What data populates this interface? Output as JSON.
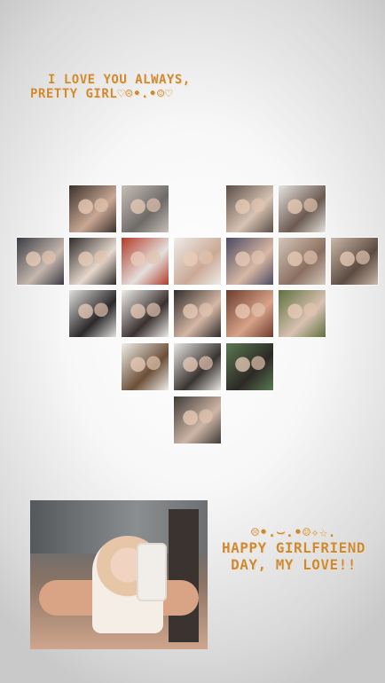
{
  "captions": {
    "top_line1": "i LOVE YOU ALWAYS,",
    "top_line2": "PRETTY giRL♡☹•.•☺♡",
    "bottom_deco": "☹•.⌣.•☺✧☆.",
    "bottom_line1": "HAPPY girLFRiEND",
    "bottom_line2": "DAY, MY LOVE!!"
  },
  "colors": {
    "caption": "#c98a3a"
  },
  "tiles": [
    {
      "id": "tile-1",
      "c1": "#3b302c",
      "c2": "#c9a894"
    },
    {
      "id": "tile-2",
      "c1": "#c7c0b8",
      "c2": "#6e6a66"
    },
    {
      "id": "tile-3",
      "c1": "#5a4d45",
      "c2": "#d7c3b4"
    },
    {
      "id": "tile-4",
      "c1": "#e7e3de",
      "c2": "#6b5a50"
    },
    {
      "id": "tile-5",
      "c1": "#3a3c44",
      "c2": "#c5b7ae"
    },
    {
      "id": "tile-6",
      "c1": "#2e2b2a",
      "c2": "#e6d8cd"
    },
    {
      "id": "tile-7",
      "c1": "#b33a2a",
      "c2": "#e3e0dc"
    },
    {
      "id": "tile-8",
      "c1": "#efece8",
      "c2": "#caa996"
    },
    {
      "id": "tile-9",
      "c1": "#4b4a63",
      "c2": "#d8b8a4"
    },
    {
      "id": "tile-10",
      "c1": "#d5c7bb",
      "c2": "#8a6f60"
    },
    {
      "id": "tile-11",
      "c1": "#cbb9a9",
      "c2": "#5c4b41"
    },
    {
      "id": "tile-12",
      "c1": "#e2e0dd",
      "c2": "#2a2829"
    },
    {
      "id": "tile-13",
      "c1": "#f0eeeb",
      "c2": "#3a3030"
    },
    {
      "id": "tile-14",
      "c1": "#2f2b2a",
      "c2": "#d6b8a6"
    },
    {
      "id": "tile-15",
      "c1": "#6a3b2a",
      "c2": "#d8a38a"
    },
    {
      "id": "tile-16",
      "c1": "#5e6f3e",
      "c2": "#d9c2b3"
    },
    {
      "id": "tile-17",
      "c1": "#f1efe9",
      "c2": "#6b4f38"
    },
    {
      "id": "tile-18",
      "c1": "#e9e7e5",
      "c2": "#3a3431"
    },
    {
      "id": "tile-19",
      "c1": "#5b7a52",
      "c2": "#2d2926"
    },
    {
      "id": "tile-20",
      "c1": "#3f3a37",
      "c2": "#cdb6a6"
    }
  ]
}
